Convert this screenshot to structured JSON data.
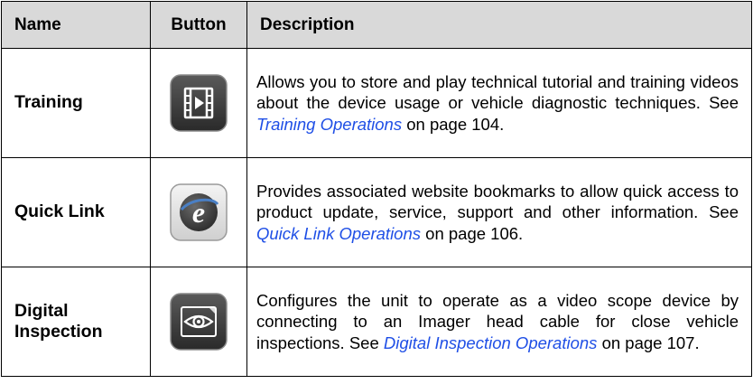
{
  "table": {
    "headers": {
      "name": "Name",
      "button": "Button",
      "description": "Description"
    },
    "rows": [
      {
        "name": "Training",
        "icon": "video-film-icon",
        "desc_before": "Allows you to store and play technical tutorial and training videos about the device usage or vehicle diagnostic techniques. See ",
        "link": "Training Operations",
        "desc_after": " on page 104."
      },
      {
        "name": "Quick Link",
        "icon": "internet-explorer-icon",
        "desc_before": "Provides associated website bookmarks to allow quick access to product update, service, support and other information. See ",
        "link": "Quick Link Operations",
        "desc_after": " on page 106."
      },
      {
        "name": "Digital Inspection",
        "icon": "eye-inspection-icon",
        "desc_before": "Configures the unit to operate as a video scope device by connecting to an Imager head cable for close vehicle inspections. See ",
        "link": "Digital Inspection Operations",
        "desc_after": " on page 107."
      }
    ]
  },
  "colors": {
    "header_bg": "#d9d9d9",
    "link": "#1f4fe6",
    "icon_dark": "#3a3a3a",
    "ie_blue": "#4a7fc4"
  }
}
